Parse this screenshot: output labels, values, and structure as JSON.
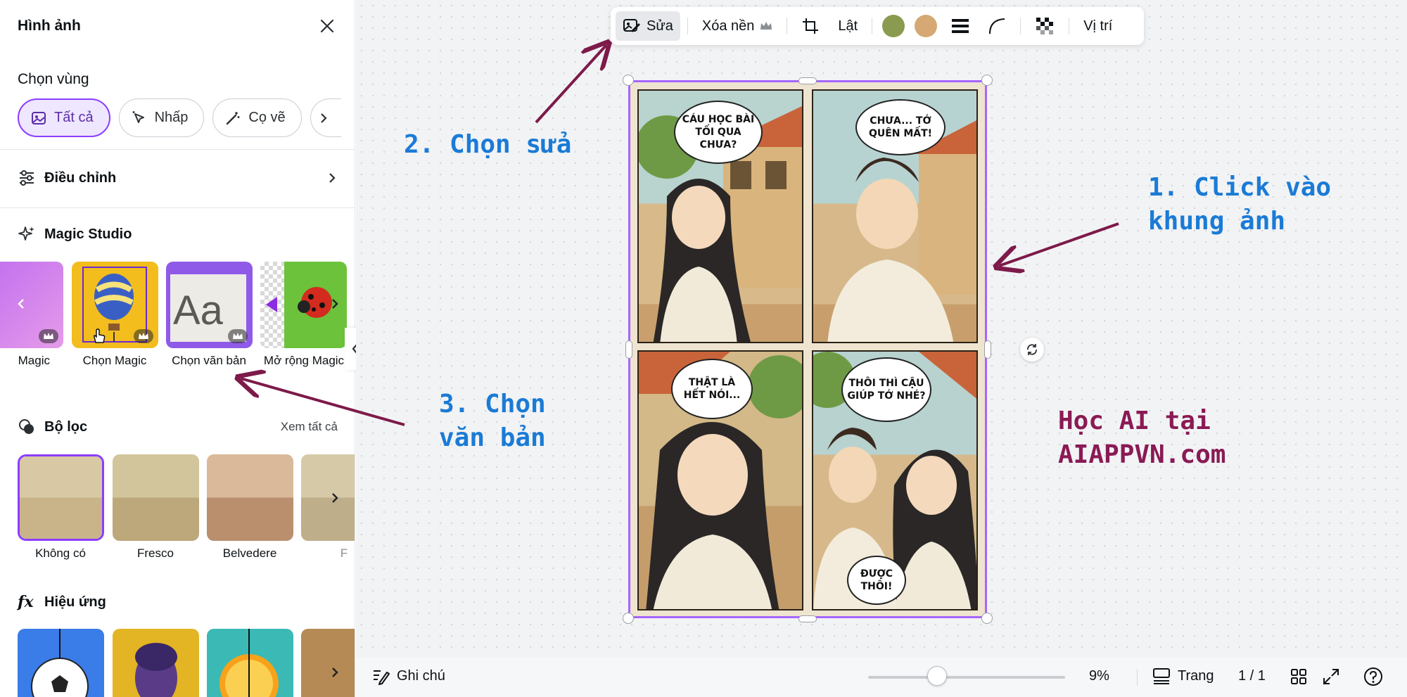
{
  "sidebar": {
    "title": "Hình ảnh",
    "select_area_label": "Chọn vùng",
    "chips": [
      {
        "label": "Tất cả"
      },
      {
        "label": "Nhấp"
      },
      {
        "label": "Cọ vẽ"
      }
    ],
    "adjust_label": "Điều chỉnh",
    "magic_studio_label": "Magic Studio",
    "magic_tools": [
      {
        "label": "Magic"
      },
      {
        "label": "Chọn Magic"
      },
      {
        "label": "Chọn văn bản"
      },
      {
        "label": "Mở rộng Magic"
      }
    ],
    "filters_label": "Bộ lọc",
    "see_all": "Xem tất cả",
    "filters": [
      {
        "label": "Không có"
      },
      {
        "label": "Fresco"
      },
      {
        "label": "Belvedere"
      },
      {
        "label": "F"
      }
    ],
    "effects_label": "Hiệu ứng"
  },
  "toolbar": {
    "edit_label": "Sửa",
    "remove_bg_label": "Xóa nền",
    "flip_label": "Lật",
    "position_label": "Vị trí",
    "colors": [
      "#8a9a4e",
      "#d6a874"
    ]
  },
  "comic": {
    "bubbles": [
      "CÁU HỌC BÀI TỐI QUA CHƯA?",
      "CHƯA... TỚ QUÊN MẤT!",
      "THẬT LÀ HẾT NÓI...",
      "THÔI THÌ CẬU GIÚP TỚ NHÉ?",
      "ĐƯỢC THÔI!"
    ]
  },
  "annotations": {
    "step1_line1": "1. Click vào",
    "step1_line2": "khung ảnh",
    "step2": "2. Chọn sửa",
    "step3_line1": "3. Chọn",
    "step3_line2": "văn bản",
    "promo_line1": "Học AI tại",
    "promo_line2": "AIAPPVN.com"
  },
  "bottombar": {
    "notes_label": "Ghi chú",
    "zoom": "9%",
    "pages_label": "Trang",
    "page_count": "1 / 1"
  }
}
